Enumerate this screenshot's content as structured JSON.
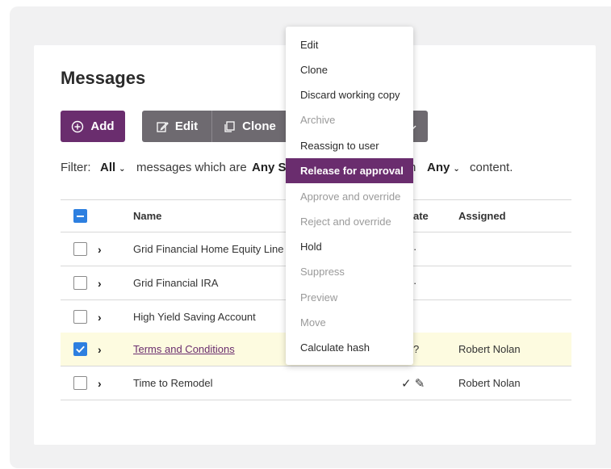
{
  "page": {
    "title": "Messages"
  },
  "toolbar": {
    "add_label": "Add",
    "edit_label": "Edit",
    "clone_label": "Clone"
  },
  "filter": {
    "prefix": "Filter:",
    "all_value": "All",
    "middle_text": "messages which are",
    "status_value": "Any St",
    "with_text": "n",
    "content_value": "Any",
    "suffix": "content."
  },
  "table": {
    "headers": {
      "name": "Name",
      "state": "ate",
      "assigned": "Assigned"
    },
    "rows": [
      {
        "name": "Grid Financial Home Equity Line o",
        "state_mark": "·",
        "assigned": "",
        "checked": false,
        "selected": false,
        "link": false
      },
      {
        "name": "Grid Financial IRA",
        "state_mark": "·",
        "assigned": "",
        "checked": false,
        "selected": false,
        "link": false
      },
      {
        "name": "High Yield Saving Account",
        "state_mark": "",
        "assigned": "",
        "checked": false,
        "selected": false,
        "link": false
      },
      {
        "name": "Terms and Conditions",
        "state_mark": "?",
        "assigned": "Robert Nolan",
        "checked": true,
        "selected": true,
        "link": true
      },
      {
        "name": "Time to Remodel",
        "state_mark": "✓ ✎",
        "assigned": "Robert Nolan",
        "checked": false,
        "selected": false,
        "link": false
      }
    ]
  },
  "menu": {
    "items": [
      {
        "label": "Edit",
        "state": "enabled"
      },
      {
        "label": "Clone",
        "state": "enabled"
      },
      {
        "label": "Discard working copy",
        "state": "enabled"
      },
      {
        "label": "Archive",
        "state": "disabled"
      },
      {
        "label": "Reassign to user",
        "state": "enabled"
      },
      {
        "label": "Release for approval",
        "state": "active"
      },
      {
        "label": "Approve and override",
        "state": "disabled"
      },
      {
        "label": "Reject and override",
        "state": "disabled"
      },
      {
        "label": "Hold",
        "state": "enabled"
      },
      {
        "label": "Suppress",
        "state": "disabled"
      },
      {
        "label": "Preview",
        "state": "disabled"
      },
      {
        "label": "Move",
        "state": "disabled"
      },
      {
        "label": "Calculate hash",
        "state": "enabled"
      }
    ]
  },
  "colors": {
    "brand_purple": "#6a2d6e",
    "button_gray": "#6e6a70",
    "checkbox_blue": "#2d7fe0",
    "selected_row": "#fdfbe0"
  },
  "icons": {
    "add": "plus-circle-icon",
    "edit": "edit-icon",
    "clone": "clone-icon",
    "more": "chevron-down-icon"
  }
}
